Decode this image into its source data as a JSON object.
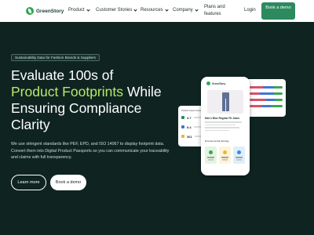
{
  "brand": {
    "name": "GreenStory"
  },
  "nav": {
    "items": [
      {
        "label": "Product"
      },
      {
        "label": "Customer Stories"
      },
      {
        "label": "Resources"
      },
      {
        "label": "Company"
      }
    ],
    "plans_label": "Plans and features",
    "login_label": "Login",
    "book_demo_label": "Book a demo"
  },
  "hero": {
    "badge": "Sustainability Data for Fashion Brands & Suppliers",
    "headline": {
      "line1": "Evaluate 100s of",
      "line2_accent": "Product Footprints",
      "line2_rest": " While",
      "line3": "Ensuring Compliance",
      "line4": "Clarity"
    },
    "description": "We use stringent standards like PEF, EPD, and ISO 14067 to display footprint data. Convert them into Digital Product Passports so you can communicate your traceability and claims with full transparency.",
    "learn_more_label": "Learn more",
    "book_demo_label": "Book a demo"
  },
  "mockup": {
    "phone_brand": "GreenStory",
    "product_title": "Men's Blue Regular Fit Jeans",
    "section_label": "Environmental Savings",
    "left_card_title": "Product Impact Comparison",
    "left_card_values": [
      "3.7",
      "8.4",
      "361"
    ]
  },
  "colors": {
    "background": "#0f2421",
    "accent": "#b8e86a",
    "brand_green": "#2d8a5e"
  }
}
